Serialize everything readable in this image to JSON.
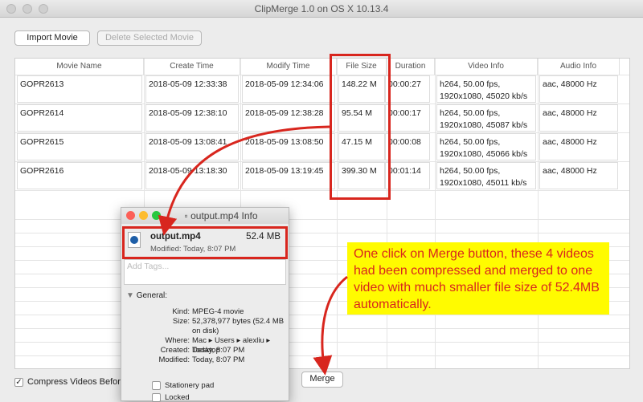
{
  "window": {
    "title": "ClipMerge 1.0 on OS X 10.13.4"
  },
  "toolbar": {
    "import": "Import Movie",
    "delete": "Delete Selected Movie"
  },
  "table": {
    "columns": [
      "Movie Name",
      "Create Time",
      "Modify Time",
      "File Size",
      "Duration",
      "Video Info",
      "Audio Info"
    ],
    "rows": [
      [
        "GOPR2613",
        "2018-05-09 12:33:38",
        "2018-05-09 12:34:06",
        "148.22 M",
        "00:00:27",
        "h264, 50.00 fps, 1920x1080, 45020 kb/s",
        "aac, 48000 Hz"
      ],
      [
        "GOPR2614",
        "2018-05-09 12:38:10",
        "2018-05-09 12:38:28",
        "95.54 M",
        "00:00:17",
        "h264, 50.00 fps, 1920x1080, 45087 kb/s",
        "aac, 48000 Hz"
      ],
      [
        "GOPR2615",
        "2018-05-09 13:08:41",
        "2018-05-09 13:08:50",
        "47.15 M",
        "00:00:08",
        "h264, 50.00 fps, 1920x1080, 45066 kb/s",
        "aac, 48000 Hz"
      ],
      [
        "GOPR2616",
        "2018-05-09 13:18:30",
        "2018-05-09 13:19:45",
        "399.30 M",
        "00:01:14",
        "h264, 50.00 fps, 1920x1080, 45011 kb/s",
        "aac, 48000 Hz"
      ]
    ]
  },
  "footer": {
    "compress_label": "Compress Videos Before",
    "compress_checked": true,
    "merge": "Merge"
  },
  "info": {
    "title": "output.mp4 Info",
    "filename": "output.mp4",
    "size": "52.4 MB",
    "modified": "Modified: Today, 8:07 PM",
    "tags_placeholder": "Add Tags...",
    "general": "General:",
    "fields": [
      [
        "Kind:",
        "MPEG-4 movie"
      ],
      [
        "Size:",
        "52,378,977 bytes (52.4 MB on disk)"
      ],
      [
        "Where:",
        "Mac ▸ Users ▸ alexliu ▸ Desktop"
      ],
      [
        "Created:",
        "Today, 8:07 PM"
      ],
      [
        "Modified:",
        "Today, 8:07 PM"
      ]
    ],
    "stationery": "Stationery pad",
    "locked": "Locked"
  },
  "annotation": {
    "text": "One click on Merge button, these 4 videos had been compressed and merged to one video with much smaller file size of 52.4MB automatically.",
    "color": "#d8261e",
    "background": "#fffb00"
  }
}
